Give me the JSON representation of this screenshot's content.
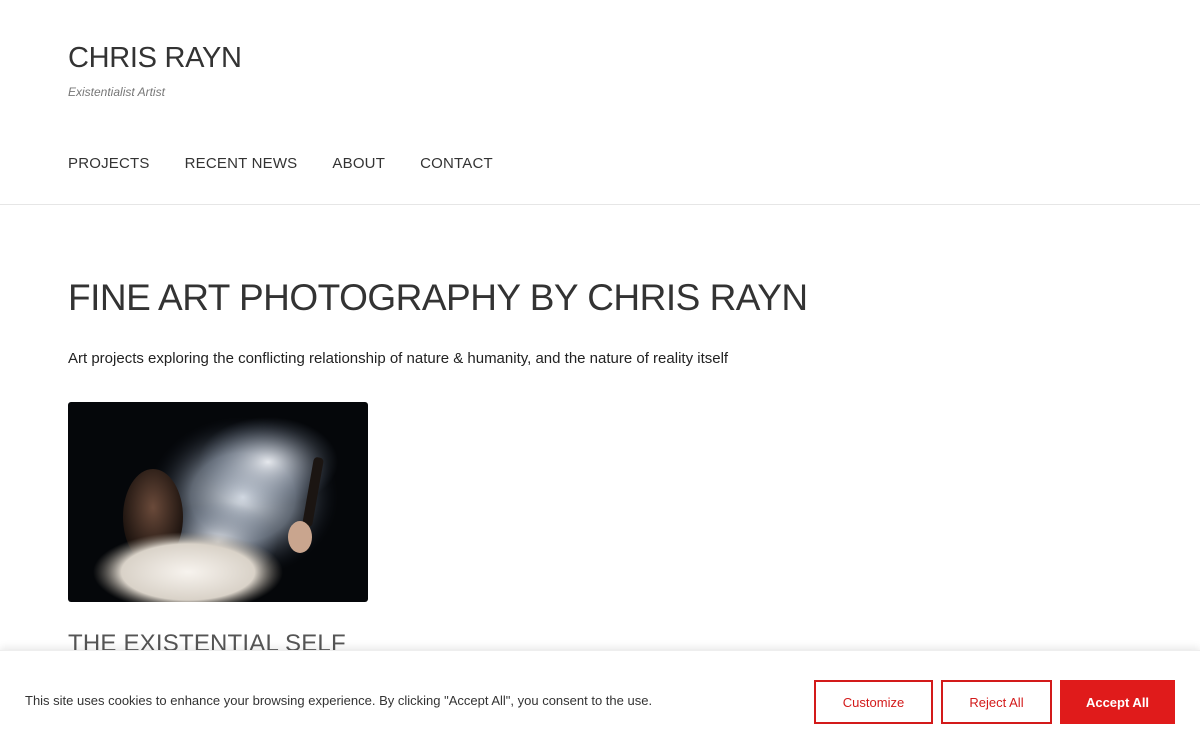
{
  "header": {
    "site_title": "CHRIS RAYN",
    "tagline": "Existentialist Artist",
    "nav": [
      {
        "label": "PROJECTS"
      },
      {
        "label": "RECENT NEWS"
      },
      {
        "label": "ABOUT"
      },
      {
        "label": "CONTACT"
      }
    ]
  },
  "main": {
    "title": "FINE ART PHOTOGRAPHY BY CHRIS RAYN",
    "intro": "Art projects exploring the conflicting relationship of nature & humanity, and the nature of reality itself",
    "projects": [
      {
        "title": "THE EXISTENTIAL SELF",
        "image": "smoke-ritual-photo"
      }
    ]
  },
  "cookie": {
    "message": "This site uses cookies to enhance your browsing experience. By clicking \"Accept All\", you consent to the use.",
    "customize_label": "Customize",
    "reject_label": "Reject All",
    "accept_label": "Accept All"
  },
  "colors": {
    "accent_red": "#e01b1b",
    "text_dark": "#333333"
  }
}
